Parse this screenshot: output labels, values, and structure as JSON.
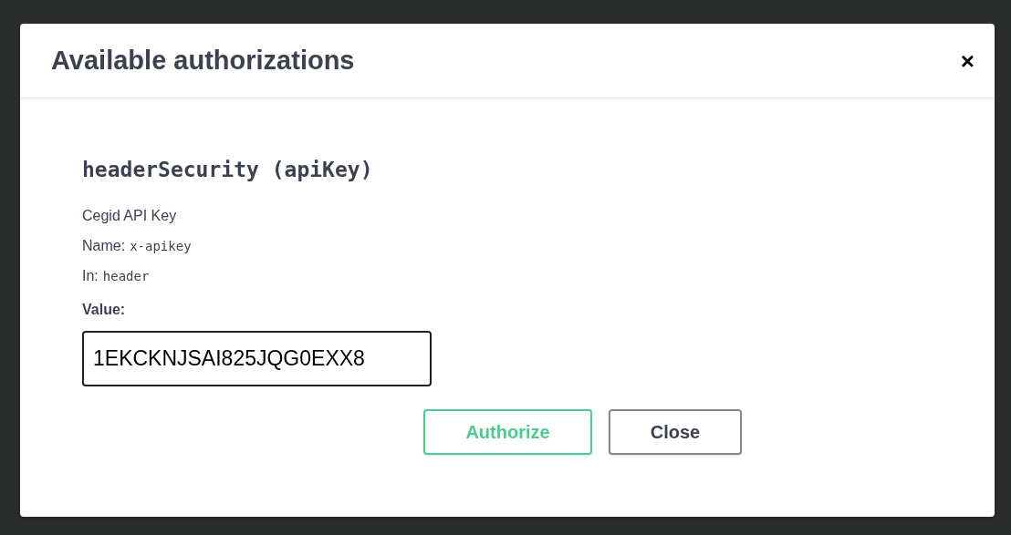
{
  "dialog": {
    "title": "Available authorizations",
    "close_icon": "×"
  },
  "scheme": {
    "heading": "headerSecurity (apiKey)",
    "description": "Cegid API Key",
    "fields": [
      {
        "label": "Name:",
        "code": "x-apikey"
      },
      {
        "label": "In:",
        "code": "header"
      }
    ],
    "value_label": "Value:",
    "value": "1EKCKNJSAI825JQG0EXX8"
  },
  "buttons": [
    {
      "label": "Authorize",
      "kind": "primary"
    },
    {
      "label": "Close",
      "kind": "secondary"
    }
  ]
}
